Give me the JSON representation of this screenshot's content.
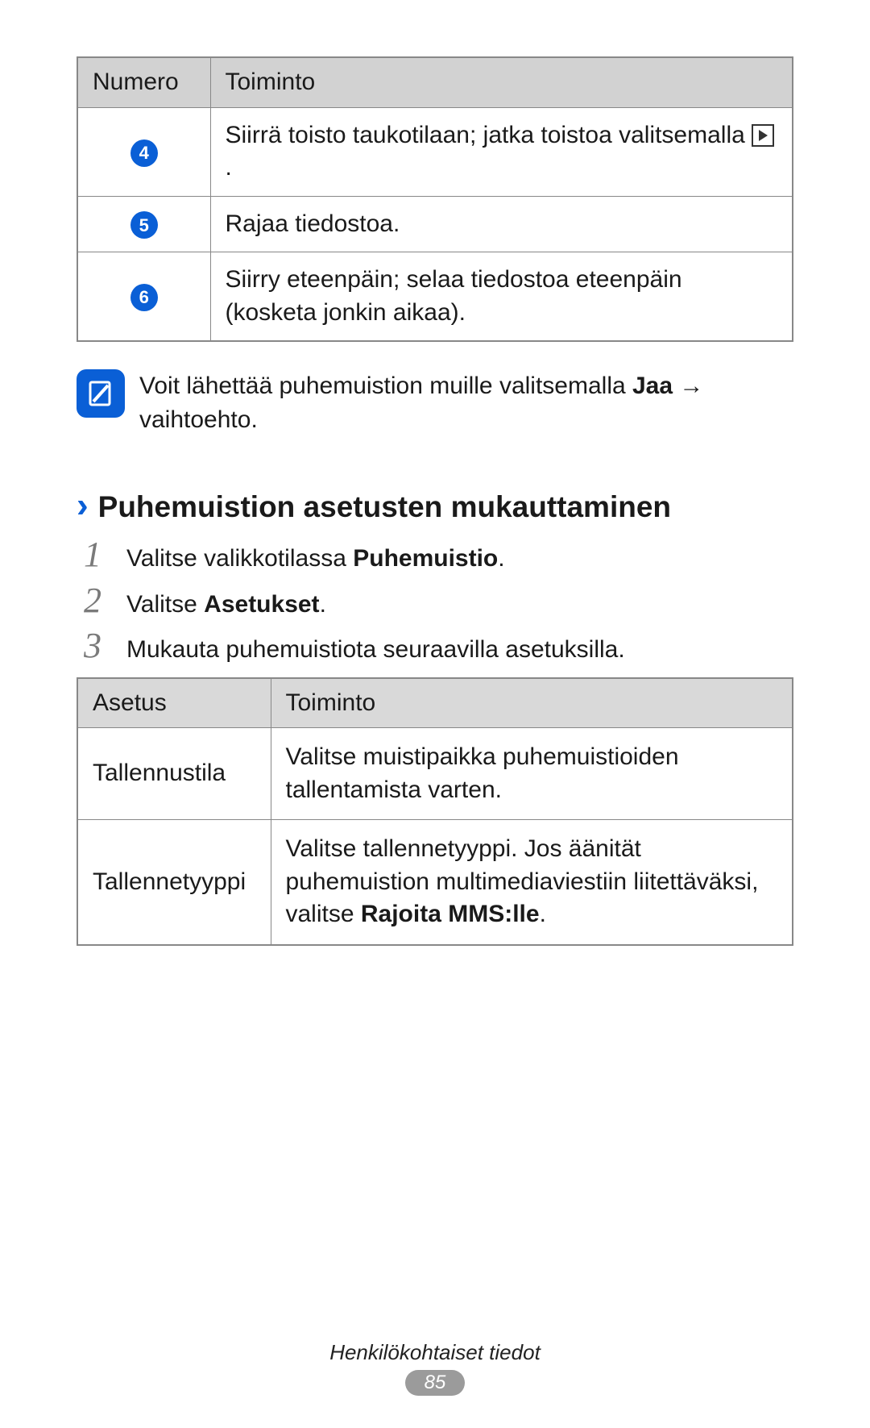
{
  "table1": {
    "header_num": "Numero",
    "header_func": "Toiminto",
    "rows": [
      {
        "num": "4",
        "func_a": "Siirrä toisto taukotilaan; jatka toistoa valitsemalla ",
        "func_b": "."
      },
      {
        "num": "5",
        "func": "Rajaa tiedostoa."
      },
      {
        "num": "6",
        "func": "Siirry eteenpäin; selaa tiedostoa eteenpäin (kosketa jonkin aikaa)."
      }
    ]
  },
  "note": {
    "pre": "Voit lähettää puhemuistion muille valitsemalla ",
    "bold": "Jaa",
    "post": " → vaihtoehto."
  },
  "section_title": "Puhemuistion asetusten mukauttaminen",
  "steps": [
    {
      "n": "1",
      "pre": "Valitse valikkotilassa ",
      "bold": "Puhemuistio",
      "post": "."
    },
    {
      "n": "2",
      "pre": "Valitse ",
      "bold": "Asetukset",
      "post": "."
    },
    {
      "n": "3",
      "pre": "Mukauta puhemuistiota seuraavilla asetuksilla.",
      "bold": "",
      "post": ""
    }
  ],
  "table2": {
    "header_setting": "Asetus",
    "header_func": "Toiminto",
    "rows": [
      {
        "setting": "Tallennustila",
        "func_pre": "Valitse muistipaikka puhemuistioiden tallentamista varten.",
        "func_bold": "",
        "func_post": ""
      },
      {
        "setting": "Tallenn­etyyppi",
        "func_pre": "Valitse tallennetyyppi. Jos äänität puhemuistion multimediaviestiin liitettäväksi, valitse ",
        "func_bold": "Rajoita MMS:lle",
        "func_post": "."
      }
    ]
  },
  "footer": {
    "section": "Henkilökohtaiset tiedot",
    "page": "85"
  }
}
